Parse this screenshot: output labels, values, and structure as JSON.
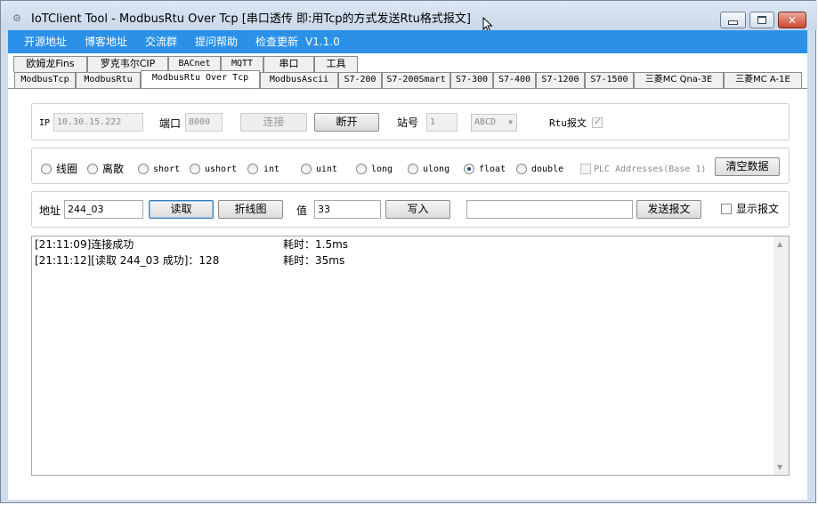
{
  "window": {
    "title": "IoTClient Tool - ModbusRtu Over Tcp [串口透传 即:用Tcp的方式发送Rtu格式报文]",
    "minimize_icon": "minimize-icon",
    "maximize_icon": "maximize-icon",
    "close_icon": "close-icon"
  },
  "menu": [
    "开源地址",
    "博客地址",
    "交流群",
    "提问帮助",
    "检查更新",
    "V1.1.0"
  ],
  "tabs_row1": [
    "欧姆龙Fins",
    "罗克韦尔CIP",
    "BACnet",
    "MQTT",
    "串口",
    "工具"
  ],
  "tabs_row2": [
    "ModbusTcp",
    "ModbusRtu",
    "ModbusRtu Over Tcp",
    "ModbusAscii",
    "S7-200",
    "S7-200Smart",
    "S7-300",
    "S7-400",
    "S7-1200",
    "S7-1500",
    "三菱MC Qna-3E",
    "三菱MC A-1E"
  ],
  "active_tab": "ModbusRtu Over Tcp",
  "connection": {
    "ip_label": "IP",
    "ip_value": "10.30.15.222",
    "port_label": "端口",
    "port_value": "8000",
    "connect_label": "连接",
    "disconnect_label": "断开",
    "station_label": "站号",
    "station_value": "1",
    "byte_order": "ABCD",
    "rtu_label": "Rtu报文",
    "rtu_checked": true
  },
  "data_types": {
    "options": [
      "线圈",
      "离散",
      "short",
      "ushort",
      "int",
      "uint",
      "long",
      "ulong",
      "float",
      "double"
    ],
    "selected": "float",
    "plc_addresses_label": "PLC Addresses(Base 1)",
    "clear_label": "清空数据"
  },
  "operation": {
    "address_label": "地址",
    "address_value": "244_03",
    "read_label": "读取",
    "chart_label": "折线图",
    "value_label": "值",
    "value_value": "33",
    "write_label": "写入",
    "packet_value": "",
    "send_label": "发送报文",
    "show_packet_label": "显示报文"
  },
  "log": [
    {
      "message": "[21:11:09]连接成功",
      "elapsed": "耗时：1.5ms"
    },
    {
      "message": "[21:11:12][读取 244_03 成功]：128",
      "elapsed": "耗时：35ms"
    }
  ],
  "colors": {
    "menubar": "#2b91e8",
    "accent": "#3c7fb1"
  }
}
